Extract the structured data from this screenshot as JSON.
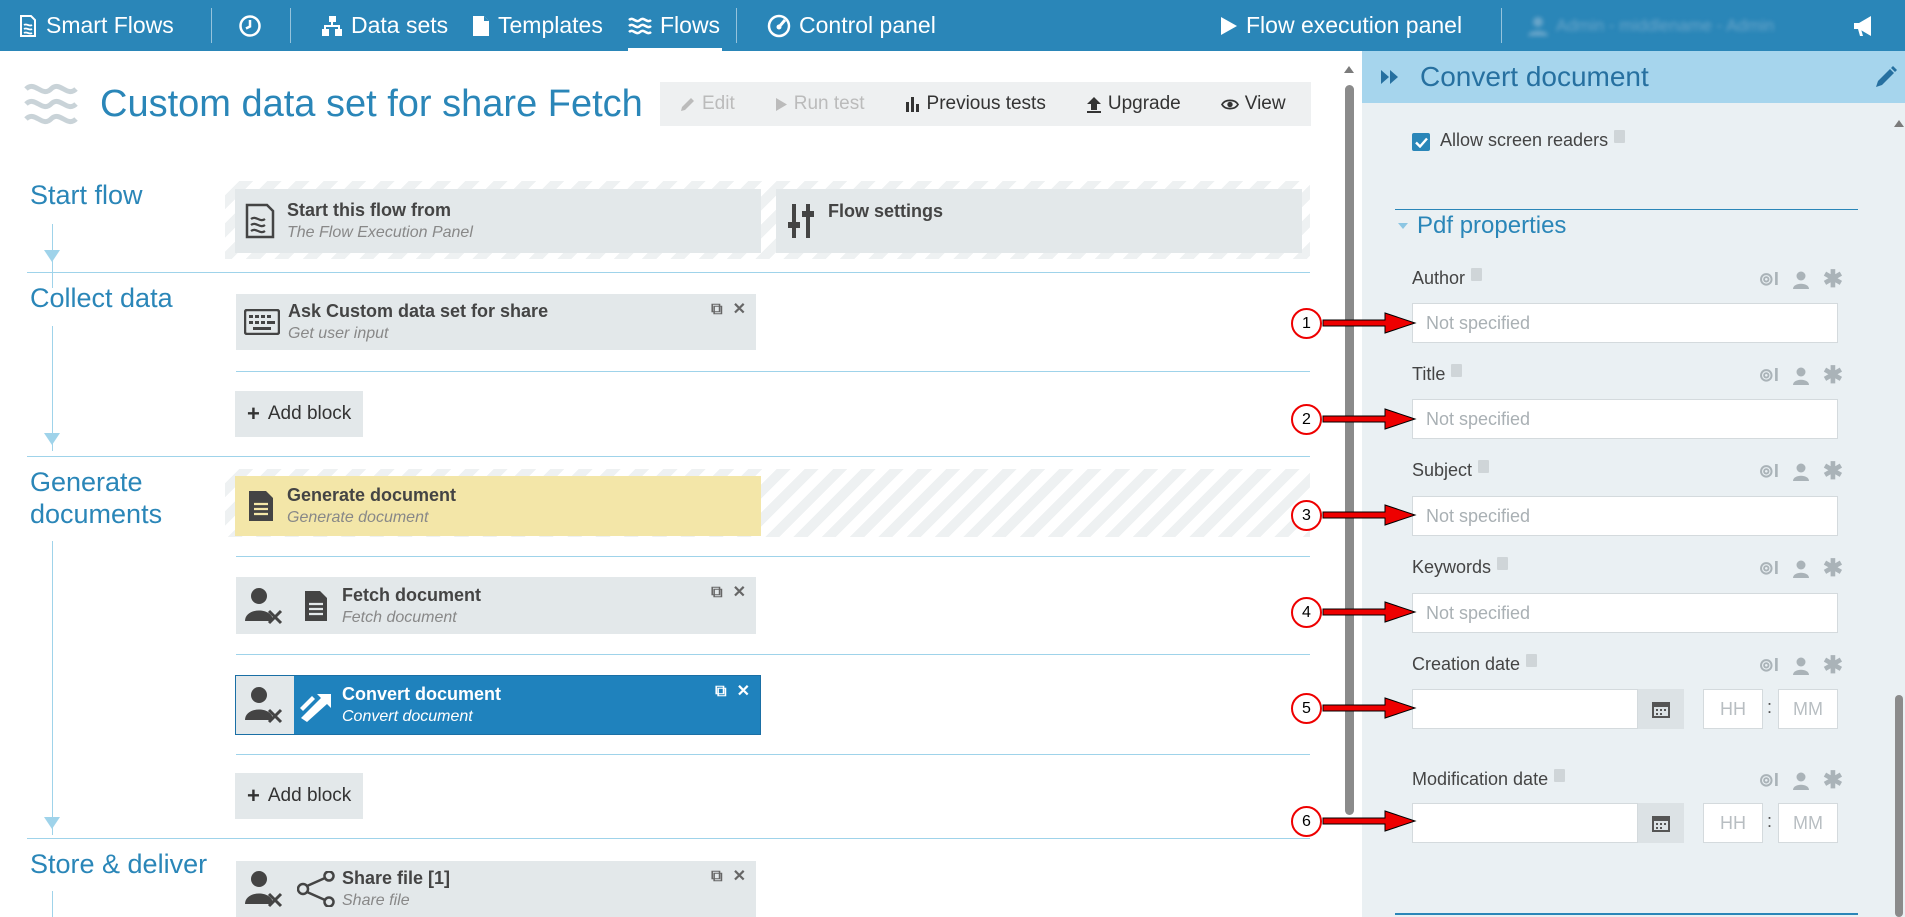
{
  "nav": {
    "brand": "Smart Flows",
    "datasets": "Data sets",
    "templates": "Templates",
    "flows": "Flows",
    "control_panel": "Control panel",
    "flow_execution": "Flow execution panel",
    "user": "Admin - middlename - Admin"
  },
  "page": {
    "title": "Custom data set for share Fetch"
  },
  "toolbar": {
    "edit": "Edit",
    "run_test": "Run test",
    "previous_tests": "Previous tests",
    "upgrade": "Upgrade",
    "view": "View"
  },
  "sections": {
    "start": "Start flow",
    "collect": "Collect data",
    "generate_line1": "Generate",
    "generate_line2": "documents",
    "store": "Store & deliver"
  },
  "blocks": {
    "start_from": {
      "title": "Start this flow from",
      "subtitle": "The Flow Execution Panel"
    },
    "flow_settings": {
      "title": "Flow settings"
    },
    "ask": {
      "title": "Ask Custom data set for share",
      "subtitle": "Get user input"
    },
    "generate": {
      "title": "Generate document",
      "subtitle": "Generate document"
    },
    "fetch": {
      "title": "Fetch document",
      "subtitle": "Fetch document"
    },
    "convert": {
      "title": "Convert document",
      "subtitle": "Convert document"
    },
    "share": {
      "title": "Share file [1]",
      "subtitle": "Share file"
    }
  },
  "add_block": "Add block",
  "panel": {
    "title": "Convert document",
    "allow_screen_readers": "Allow screen readers",
    "allow_screen_readers_checked": true,
    "pdf_section": "Pdf properties",
    "fields": {
      "author": {
        "label": "Author",
        "placeholder": "Not specified"
      },
      "title": {
        "label": "Title",
        "placeholder": "Not specified"
      },
      "subject": {
        "label": "Subject",
        "placeholder": "Not specified"
      },
      "keywords": {
        "label": "Keywords",
        "placeholder": "Not specified"
      },
      "creation_date": {
        "label": "Creation date",
        "hh": "HH",
        "mm": "MM"
      },
      "modification_date": {
        "label": "Modification date",
        "hh": "HH",
        "mm": "MM"
      }
    }
  },
  "callouts": [
    "1",
    "2",
    "3",
    "4",
    "5",
    "6"
  ],
  "colors": {
    "nav_bg": "#2a86b8",
    "accent": "#2a86b8",
    "panel_header": "#a6d5ed",
    "selected_block": "#1f82bd",
    "generate_block": "#f3e6a8",
    "callout_red": "#e00000"
  }
}
